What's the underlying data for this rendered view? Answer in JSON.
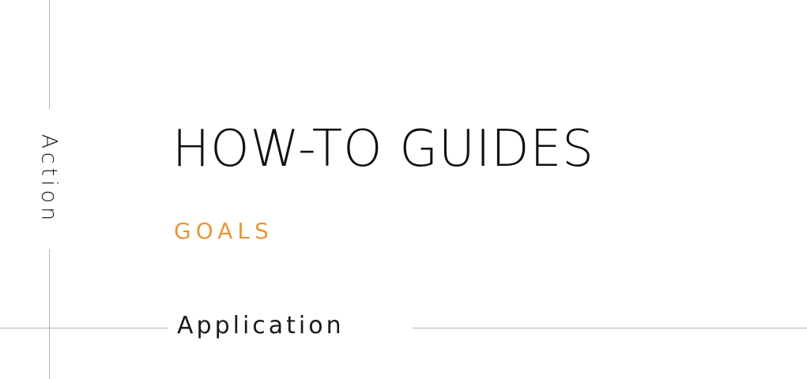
{
  "axes": {
    "vertical_label": "Action",
    "horizontal_label": "Application"
  },
  "quadrant": {
    "title": "HOW-TO GUIDES",
    "subtitle": "GOALS"
  },
  "colors": {
    "accent": "#e8963a",
    "axis_line": "#b3b3b3",
    "text": "#111111"
  }
}
